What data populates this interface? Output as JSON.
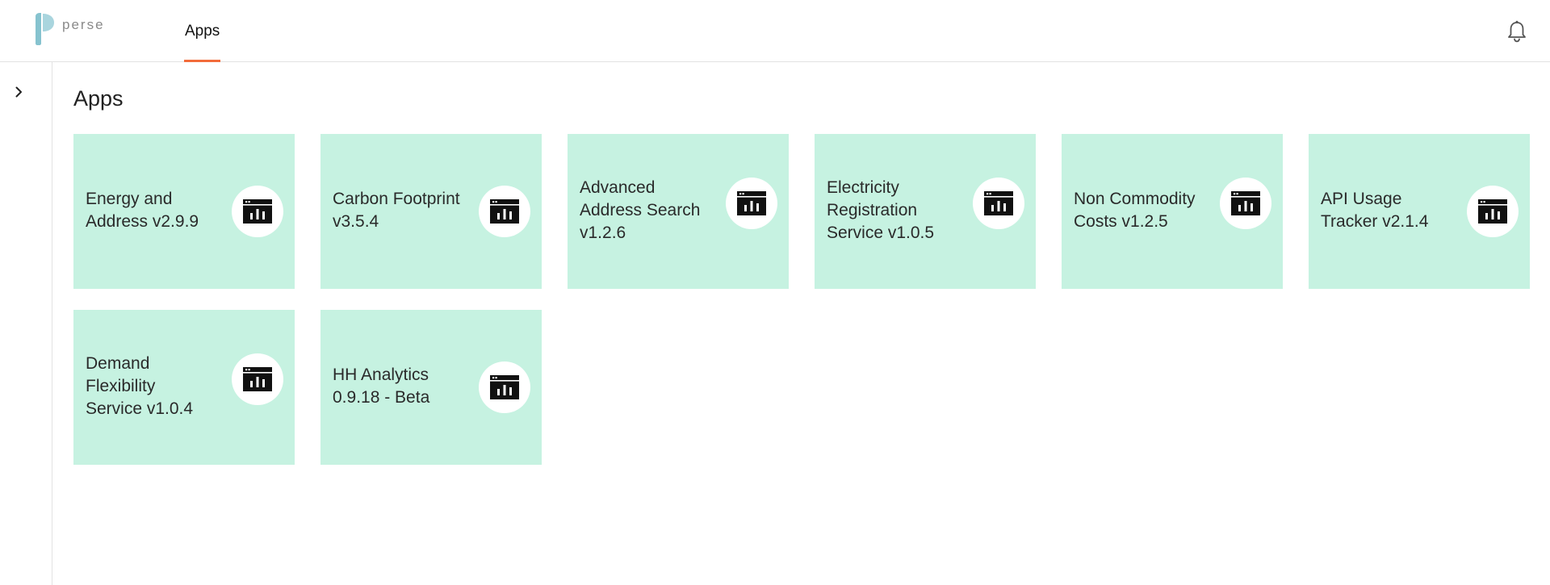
{
  "header": {
    "logo_text": "perse",
    "nav_tab_label": "Apps",
    "accent_color": "#f26b3a"
  },
  "sidebar": {
    "toggle_icon": "chevron-right-icon"
  },
  "main": {
    "title": "Apps",
    "card_color": "#c6f2e1",
    "cards": [
      {
        "label": "Energy and Address v2.9.9",
        "icon": "app-chart-icon"
      },
      {
        "label": "Carbon Footprint v3.5.4",
        "icon": "app-chart-icon"
      },
      {
        "label": "Advanced Address Search v1.2.6",
        "icon": "app-chart-icon"
      },
      {
        "label": "Electricity Registration Service v1.0.5",
        "icon": "app-chart-icon"
      },
      {
        "label": "Non Commodity Costs v1.2.5",
        "icon": "app-chart-icon"
      },
      {
        "label": "API Usage Tracker v2.1.4",
        "icon": "app-chart-icon"
      },
      {
        "label": "Demand Flexibility Service v1.0.4",
        "icon": "app-chart-icon"
      },
      {
        "label": "HH Analytics 0.9.18 - Beta",
        "icon": "app-chart-icon"
      }
    ]
  }
}
